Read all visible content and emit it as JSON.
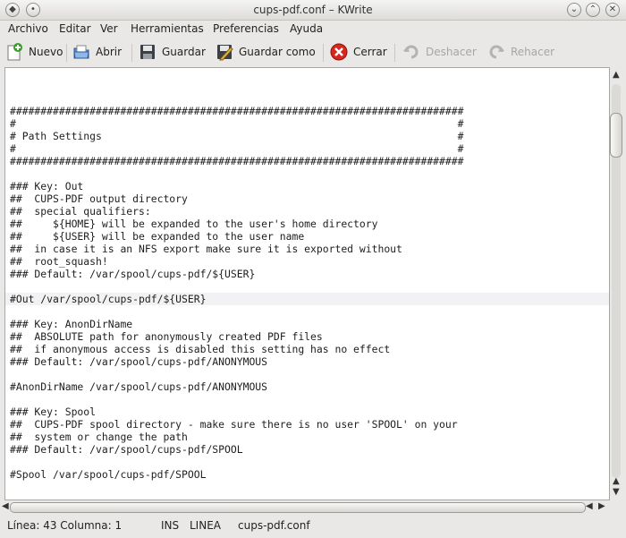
{
  "window": {
    "title": "cups-pdf.conf – KWrite"
  },
  "menu": {
    "items": [
      "Archivo",
      "Editar",
      "Ver",
      "Herramientas",
      "Preferencias",
      "Ayuda"
    ]
  },
  "toolbar": {
    "new_label": "Nuevo",
    "open_label": "Abrir",
    "save_label": "Guardar",
    "save_as_label": "Guardar como",
    "close_label": "Cerrar",
    "undo_label": "Deshacer",
    "redo_label": "Rehacer"
  },
  "editor": {
    "current_line": 17,
    "lines": [
      "",
      "##########################################################################",
      "#                                                                        #",
      "# Path Settings                                                          #",
      "#                                                                        #",
      "##########################################################################",
      "",
      "### Key: Out",
      "##  CUPS-PDF output directory",
      "##  special qualifiers:",
      "##     ${HOME} will be expanded to the user's home directory",
      "##     ${USER} will be expanded to the user name",
      "##  in case it is an NFS export make sure it is exported without",
      "##  root_squash!",
      "### Default: /var/spool/cups-pdf/${USER}",
      "",
      "#Out /var/spool/cups-pdf/${USER}",
      "",
      "### Key: AnonDirName",
      "##  ABSOLUTE path for anonymously created PDF files",
      "##  if anonymous access is disabled this setting has no effect",
      "### Default: /var/spool/cups-pdf/ANONYMOUS",
      "",
      "#AnonDirName /var/spool/cups-pdf/ANONYMOUS",
      "",
      "### Key: Spool",
      "##  CUPS-PDF spool directory - make sure there is no user 'SPOOL' on your",
      "##  system or change the path",
      "### Default: /var/spool/cups-pdf/SPOOL",
      "",
      "#Spool /var/spool/cups-pdf/SPOOL",
      "",
      "",
      "##########################################################################"
    ]
  },
  "status": {
    "position": "Línea: 43 Columna: 1",
    "mode": "INS",
    "selection_mode": "LINEA",
    "filename": "cups-pdf.conf"
  },
  "colors": {
    "accent_close": "#d8281e",
    "editor_background": "#ffffff",
    "window_background": "#e9e8e6"
  }
}
